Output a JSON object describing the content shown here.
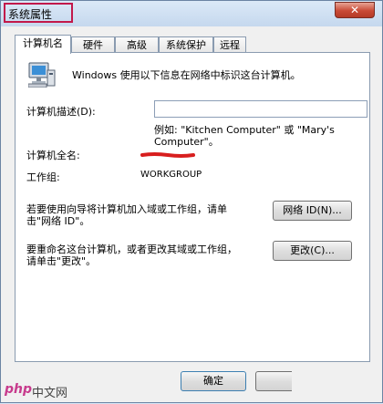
{
  "window": {
    "title": "系统属性",
    "close_label": "✕"
  },
  "tabs": [
    {
      "label": "计算机名",
      "active": true
    },
    {
      "label": "硬件"
    },
    {
      "label": "高级"
    },
    {
      "label": "系统保护"
    },
    {
      "label": "远程"
    }
  ],
  "panel": {
    "intro": "Windows 使用以下信息在网络中标识这台计算机。",
    "description_label": "计算机描述(D):",
    "description_value": "",
    "example_line1": "例如: \"Kitchen Computer\" 或 \"Mary's",
    "example_line2": "Computer\"。",
    "full_name_label": "计算机全名:",
    "workgroup_label": "工作组:",
    "workgroup_value": "WORKGROUP",
    "network_text_line1": "若要使用向导将计算机加入域或工作组，请单",
    "network_text_line2": "击\"网络 ID\"。",
    "network_id_button": "网络 ID(N)...",
    "rename_text_line1": "要重命名这台计算机，或者更改其域或工作组，",
    "rename_text_line2": "请单击\"更改\"。",
    "change_button": "更改(C)..."
  },
  "footer": {
    "ok_button": "确定"
  },
  "watermark": {
    "text_php": "php",
    "text_site": "中文网"
  }
}
